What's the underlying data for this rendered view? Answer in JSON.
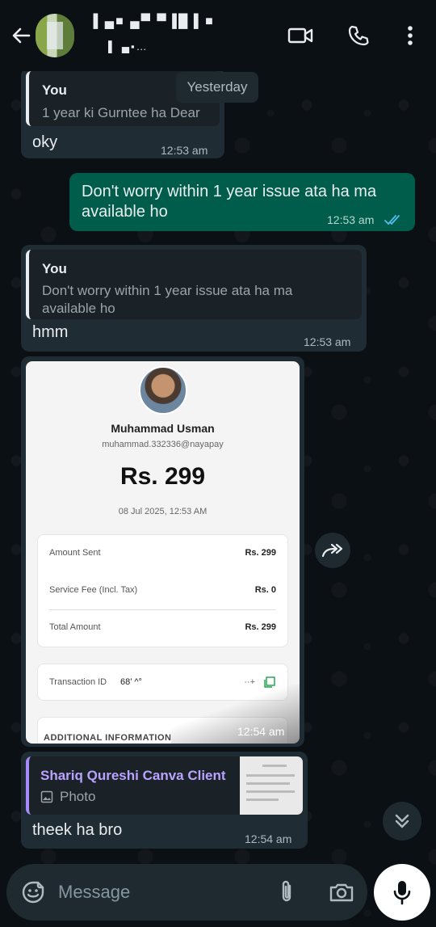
{
  "header": {
    "contact_name": "▐ ▄■ ▄▀  ▀▐█▐ ■",
    "contact_status": "▌ ▄▪…"
  },
  "date_chip": "Yesterday",
  "messages": [
    {
      "quote_author": "You",
      "quote_text": "1 year ki Gurntee ha Dear",
      "text": "oky",
      "time": "12:53 am"
    },
    {
      "text_line1": "Don't worry within 1 year issue ata ha ma",
      "text_line2": "available ho",
      "time": "12:53 am"
    },
    {
      "quote_author": "You",
      "quote_text_line1": "Don't worry within 1 year issue ata ha ma",
      "quote_text_line2": "available ho",
      "text": "hmm",
      "time": "12:53 am"
    },
    {
      "time": "12:54 am"
    },
    {
      "quote_author": "Shariq Qureshi Canva Client",
      "quote_type": "Photo",
      "text": "theek ha bro",
      "time": "12:54 am"
    }
  ],
  "receipt": {
    "name": "Muhammad Usman",
    "email": "muhammad.332336@nayapay",
    "amount": "Rs. 299",
    "date": "08 Jul 2025, 12:53 AM",
    "rows": [
      {
        "label": "Amount Sent",
        "value": "Rs. 299"
      },
      {
        "label": "Service Fee (Incl. Tax)",
        "value": "Rs. 0"
      },
      {
        "label": "Total Amount",
        "value": "Rs. 299"
      }
    ],
    "transaction_label": "Transaction ID",
    "transaction_value": "68’ ^°",
    "transaction_tail": "··+",
    "additional": "ADDITIONAL INFORMATION"
  },
  "input": {
    "placeholder": "Message"
  },
  "colors": {
    "incoming": "#202c33",
    "outgoing": "#005c4b",
    "accent": "#53bdeb",
    "quote_purple": "#a78bfa"
  }
}
